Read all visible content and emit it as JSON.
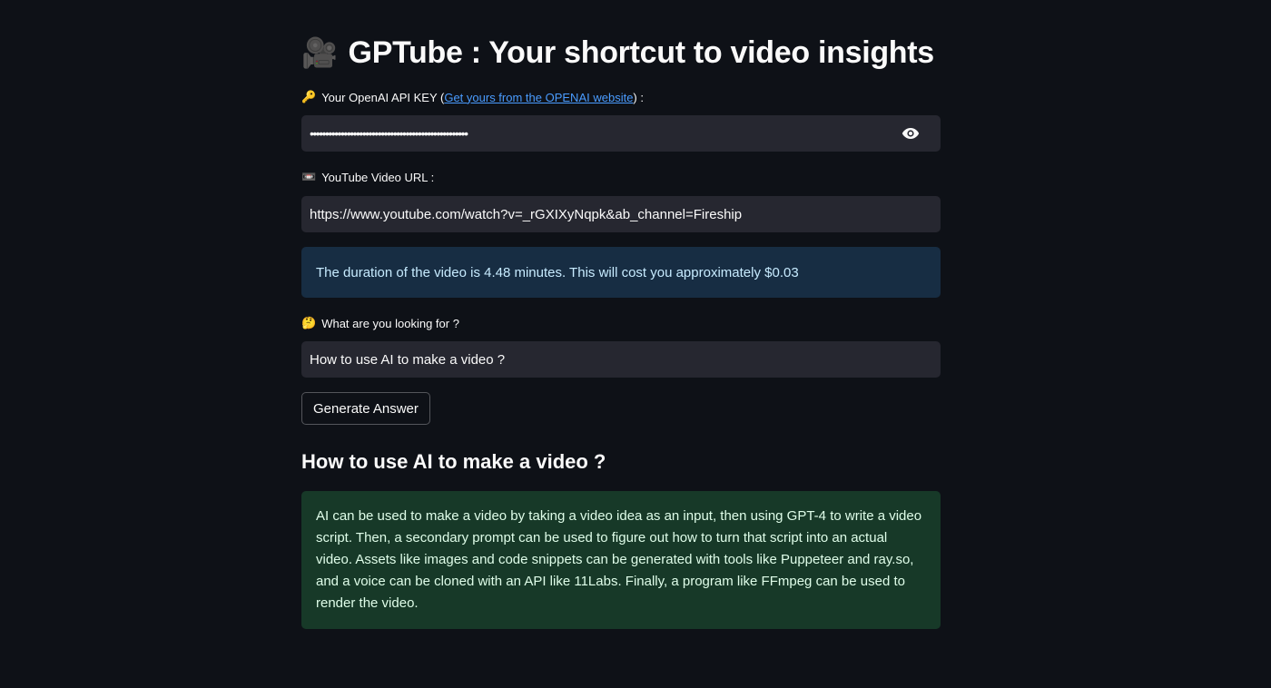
{
  "header": {
    "title_icon": "🎥",
    "title": "GPTube : Your shortcut to video insights"
  },
  "api_key": {
    "label_icon": "🔑",
    "label_prefix": "Your OpenAI API KEY (",
    "link_text": "Get yours from the OPENAI website",
    "label_suffix": ") :",
    "value": "•••••••••••••••••••••••••••••••••••••••••••••••••••",
    "toggle_icon": "eye-icon"
  },
  "video_url": {
    "label_icon": "📼",
    "label": "YouTube Video URL :",
    "value": "https://www.youtube.com/watch?v=_rGXIXyNqpk&ab_channel=Fireship"
  },
  "info_message": "The duration of the video is 4.48 minutes. This will cost you approximately $0.03",
  "query": {
    "label_icon": "🤔",
    "label": "What are you looking for ?",
    "value": "How to use AI to make a video ?"
  },
  "generate_button": "Generate Answer",
  "answer": {
    "heading": "How to use AI to make a video ?",
    "text": "AI can be used to make a video by taking a video idea as an input, then using GPT-4 to write a video script. Then, a secondary prompt can be used to figure out how to turn that script into an actual video. Assets like images and code snippets can be generated with tools like Puppeteer and ray.so, and a voice can be cloned with an API like 11Labs. Finally, a program like FFmpeg can be used to render the video."
  },
  "colors": {
    "background": "#0e1117",
    "input_background": "#262730",
    "info_background": "#172d43",
    "info_text": "#c7ebff",
    "success_background": "#173928",
    "success_text": "#dffde9",
    "link": "#4a9cff"
  }
}
